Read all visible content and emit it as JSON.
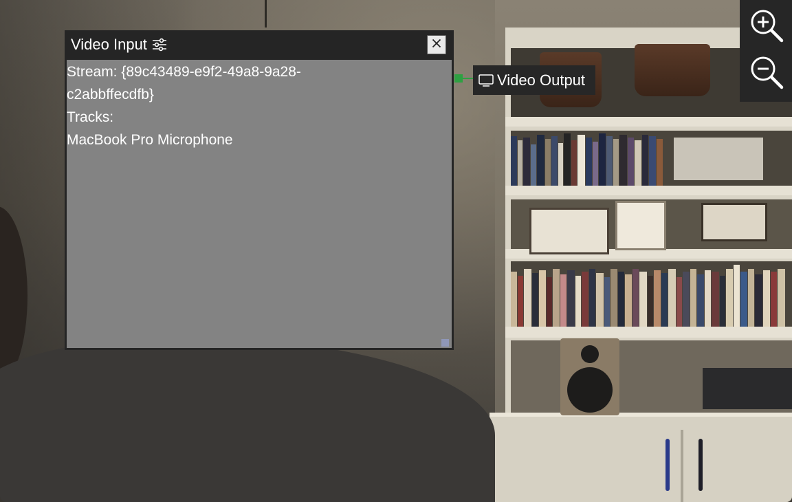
{
  "node": {
    "title": "Video Input",
    "settings_icon": "sliders-icon",
    "close_icon": "close-icon",
    "stream_line_1": "Stream: {89c43489-e9f2-49a8-9a28-",
    "stream_line_2": "c2abbffecdfb}",
    "tracks_label": "Tracks:",
    "track_name": "MacBook Pro Microphone"
  },
  "output": {
    "label": "Video Output",
    "icon": "monitor-icon"
  },
  "zoom": {
    "zoom_in_icon": "zoom-in-icon",
    "zoom_out_icon": "zoom-out-icon"
  },
  "colors": {
    "node_background": "#838383",
    "node_header": "#252525",
    "connection": "#2ea042",
    "panel": "#262626"
  }
}
